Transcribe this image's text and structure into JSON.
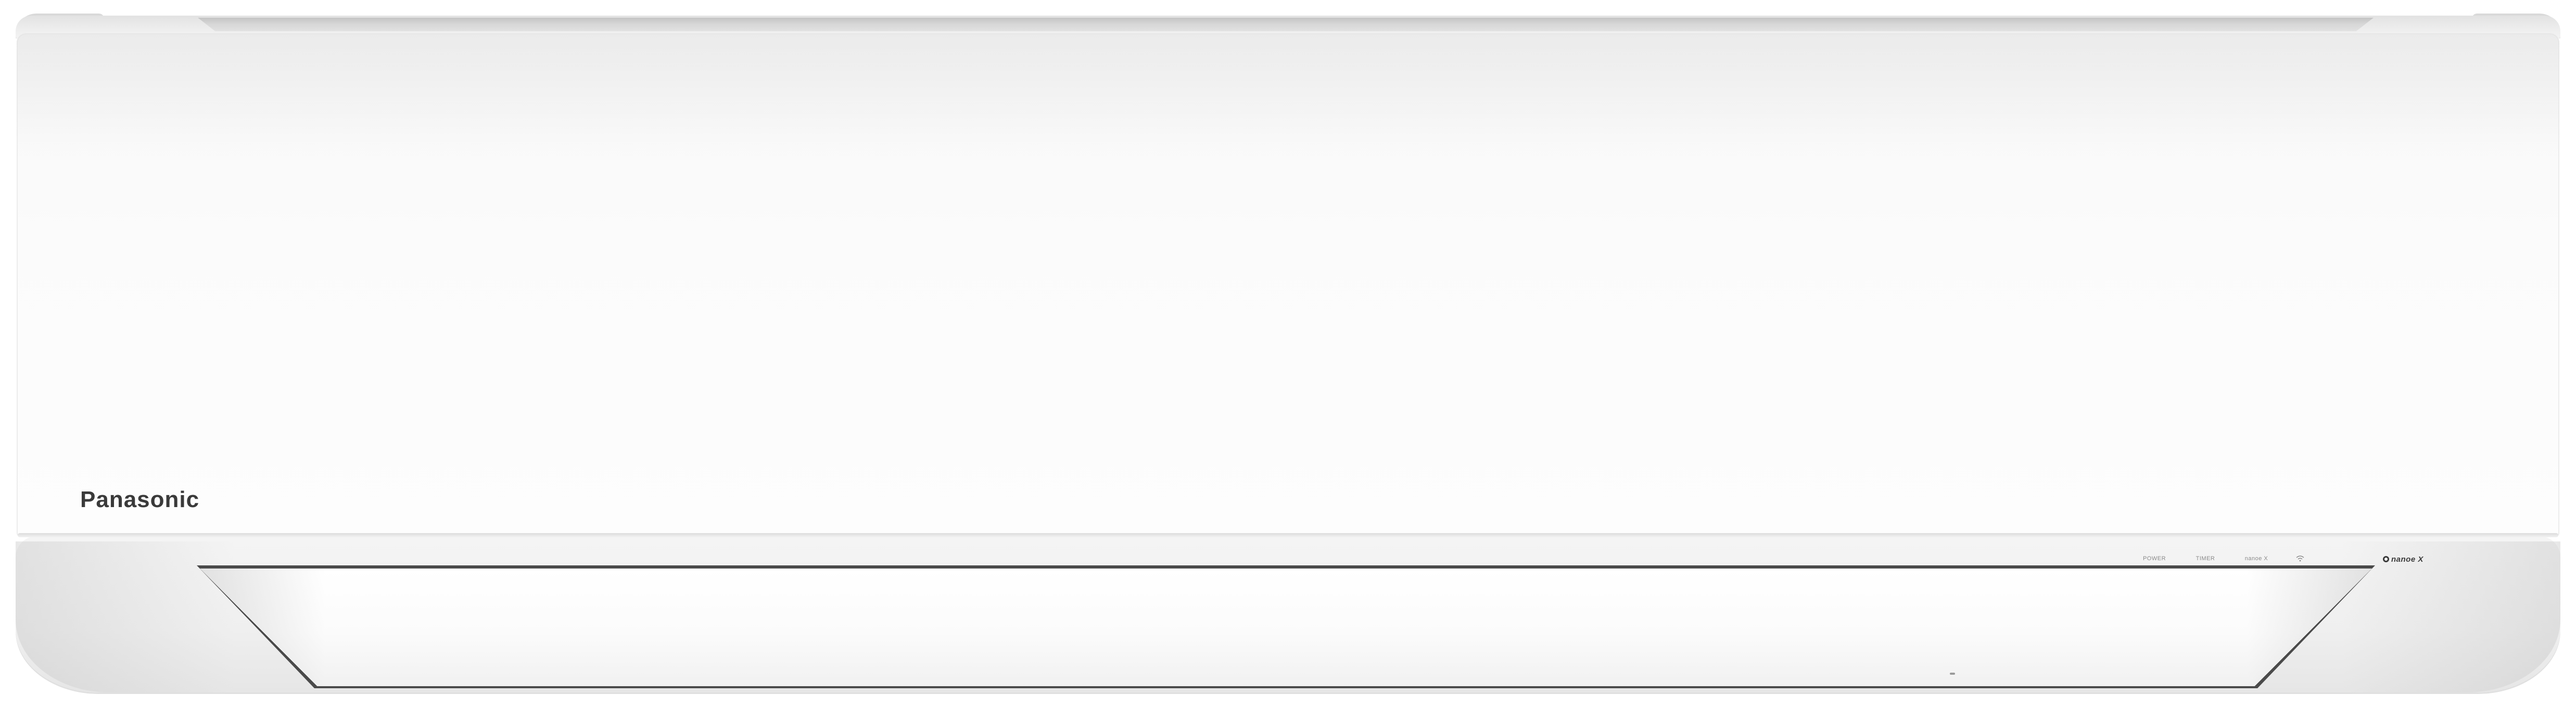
{
  "brand": {
    "logo_text": "Panasonic",
    "logo_color": "#3a3a3a"
  },
  "indicators": [
    {
      "label": "POWER"
    },
    {
      "label": "TIMER"
    },
    {
      "label": "nanoe X"
    }
  ],
  "wifi_indicator": {
    "icon": "wifi-icon"
  },
  "nanoe_badge": {
    "icon": "nanoe-icon",
    "text": "nanoe X"
  },
  "colors": {
    "body": "#f7f7f7",
    "louver_frame": "#4a4a4a",
    "indicator_text": "#8a8a8a"
  }
}
